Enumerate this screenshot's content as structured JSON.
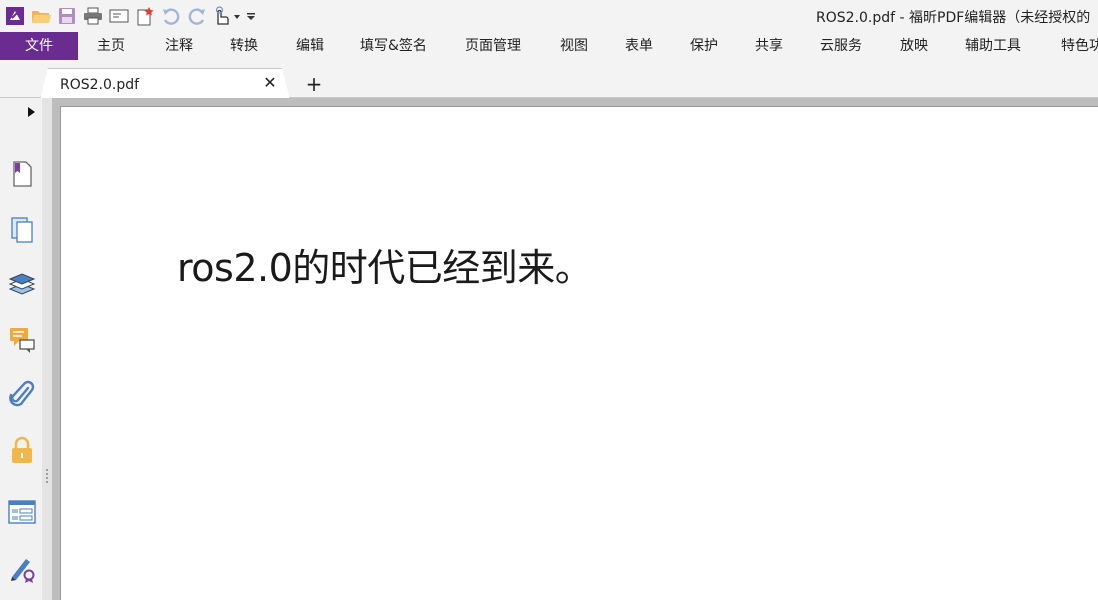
{
  "window": {
    "title": "ROS2.0.pdf - 福昕PDF编辑器（未经授权的"
  },
  "quick_access": {
    "icons": [
      "app-logo-icon",
      "open-folder-icon",
      "save-icon",
      "print-icon",
      "scan-icon",
      "new-icon",
      "undo-icon",
      "redo-icon",
      "hand-tool-icon",
      "customize-icon"
    ]
  },
  "ribbon": {
    "file": "文件",
    "home": "主页",
    "comment": "注释",
    "convert": "转换",
    "edit": "编辑",
    "fill_sign": "填写&签名",
    "organize": "页面管理",
    "view": "视图",
    "form": "表单",
    "protect": "保护",
    "share": "共享",
    "cloud": "云服务",
    "present": "放映",
    "accessibility": "辅助工具",
    "features": "特色功"
  },
  "tabs": {
    "active_label": "ROS2.0.pdf",
    "close_glyph": "✕",
    "new_glyph": "+"
  },
  "navpane": {
    "items": [
      "bookmarks",
      "pages",
      "layers",
      "comments",
      "attachments",
      "security",
      "form-fields",
      "signatures"
    ]
  },
  "document": {
    "text": "ros2.0的时代已经到来。"
  },
  "colors": {
    "brand": "#6b2c91",
    "toolbar_bg": "#f3f3f3",
    "viewport_bg": "#bdbdbd"
  }
}
